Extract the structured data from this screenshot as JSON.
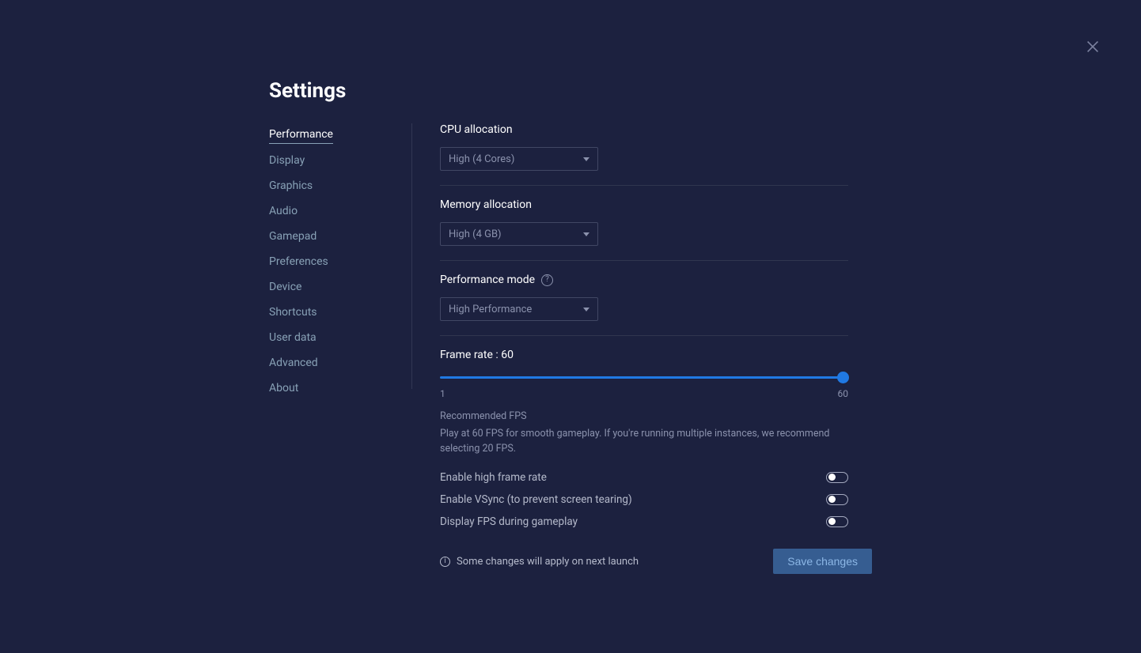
{
  "title": "Settings",
  "sidebar": {
    "items": [
      {
        "label": "Performance",
        "active": true
      },
      {
        "label": "Display"
      },
      {
        "label": "Graphics"
      },
      {
        "label": "Audio"
      },
      {
        "label": "Gamepad"
      },
      {
        "label": "Preferences"
      },
      {
        "label": "Device"
      },
      {
        "label": "Shortcuts"
      },
      {
        "label": "User data"
      },
      {
        "label": "Advanced"
      },
      {
        "label": "About"
      }
    ]
  },
  "cpu": {
    "label": "CPU allocation",
    "value": "High (4 Cores)"
  },
  "memory": {
    "label": "Memory allocation",
    "value": "High (4 GB)"
  },
  "perfmode": {
    "label": "Performance mode",
    "value": "High Performance"
  },
  "fps": {
    "label_prefix": "Frame rate : ",
    "value": "60",
    "min": "1",
    "max": "60",
    "recommend_title": "Recommended FPS",
    "recommend_body": "Play at 60 FPS for smooth gameplay. If you're running multiple instances, we recommend selecting 20 FPS."
  },
  "toggles": {
    "high_frame_rate": "Enable high frame rate",
    "vsync": "Enable VSync (to prevent screen tearing)",
    "display_fps": "Display FPS during gameplay"
  },
  "footer": {
    "note": "Some changes will apply on next launch",
    "save": "Save changes"
  }
}
